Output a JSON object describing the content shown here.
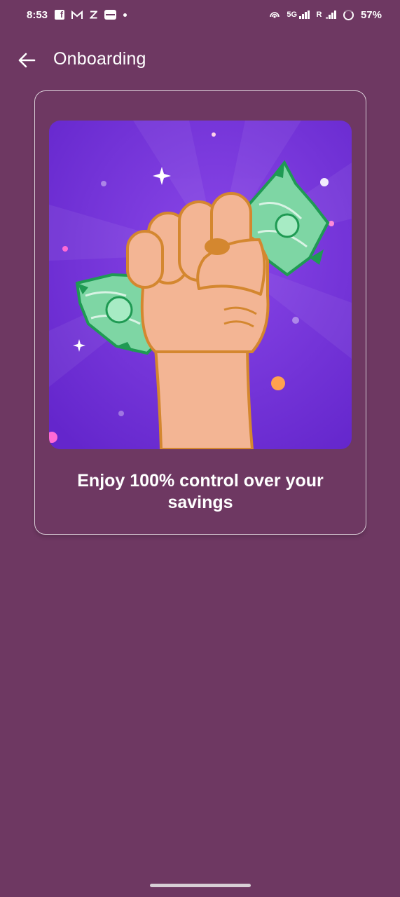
{
  "status_bar": {
    "time": "8:53",
    "network_label": "5G",
    "roaming_label": "R",
    "battery": "57%",
    "icons": [
      "facebook-icon",
      "gmail-icon",
      "zomato-icon",
      "paytm-icon",
      "notification-dot-icon",
      "hotspot-icon",
      "signal-icon",
      "battery-icon"
    ]
  },
  "app_bar": {
    "title": "Onboarding",
    "back_icon": "arrow-left-icon"
  },
  "onboarding": {
    "illustration_icon": "fist-holding-money-illustration",
    "caption": "Enjoy 100% control over your savings"
  },
  "colors": {
    "background": "#6e3862",
    "illustration_bg": "#6a2cd0",
    "money_green": "#7ed6a4",
    "skin": "#f3b594"
  }
}
